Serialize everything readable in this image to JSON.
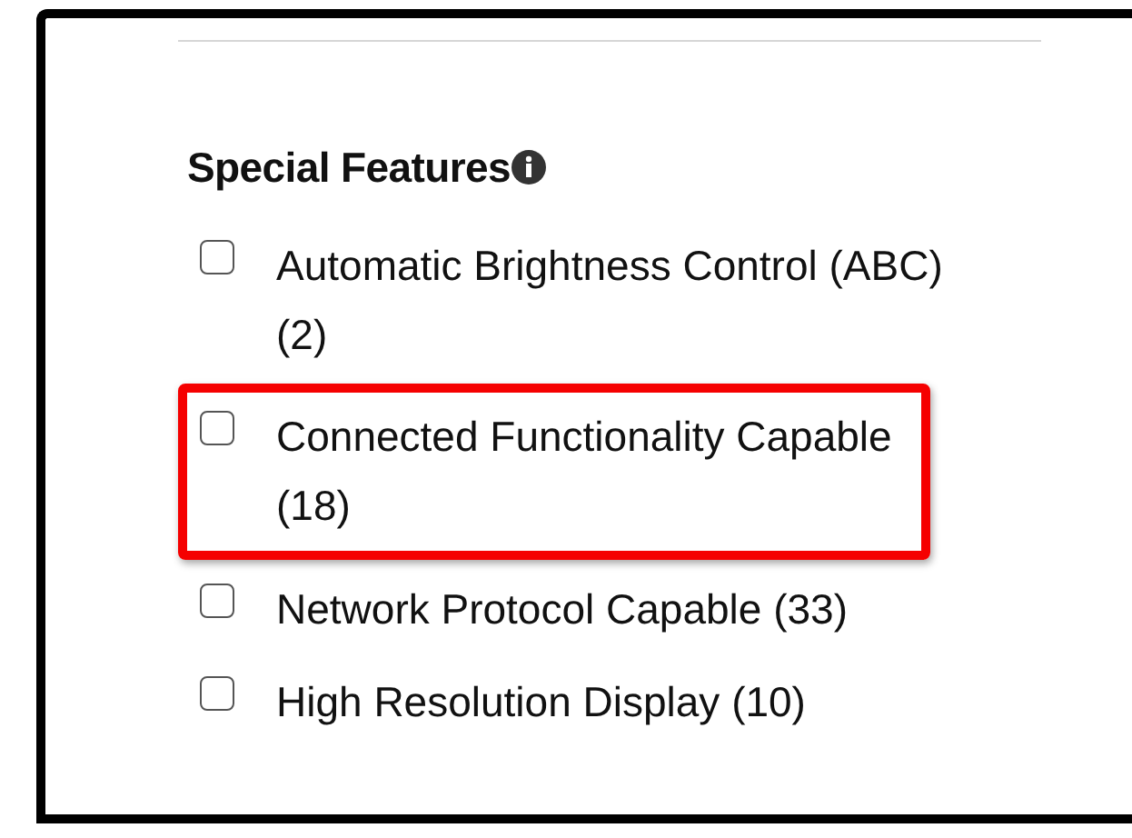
{
  "section": {
    "title": "Special Features"
  },
  "options": [
    {
      "label": "Automatic Brightness Control (ABC) (2)",
      "checked": false,
      "highlighted": false
    },
    {
      "label": "Connected Functionality Capable (18)",
      "checked": false,
      "highlighted": true
    },
    {
      "label": "Network Protocol Capable (33)",
      "checked": false,
      "highlighted": false
    },
    {
      "label": "High Resolution Display (10)",
      "checked": false,
      "highlighted": false
    }
  ]
}
